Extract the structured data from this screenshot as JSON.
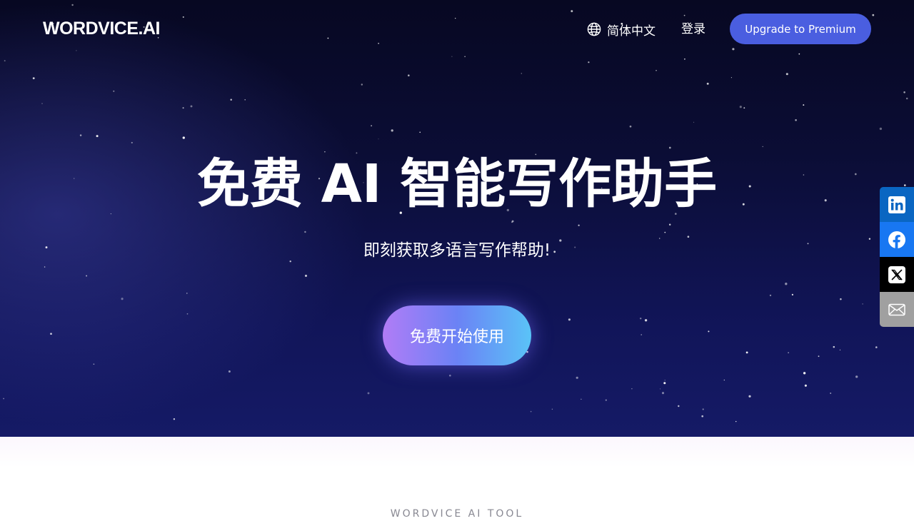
{
  "header": {
    "logo_text": "WORDVICE.AI",
    "language_label": "简体中文",
    "login_label": "登录",
    "upgrade_label": "Upgrade to Premium",
    "language_icon": "globe-icon"
  },
  "hero": {
    "title": "免费 AI 智能写作助手",
    "subtitle": "即刻获取多语言写作帮助!",
    "cta_label": "免费开始使用"
  },
  "social": [
    {
      "name": "linkedin",
      "icon": "linkedin-icon",
      "color": "#0a66c2"
    },
    {
      "name": "facebook",
      "icon": "facebook-icon",
      "color": "#1877f2"
    },
    {
      "name": "x",
      "icon": "x-icon",
      "color": "#000000"
    },
    {
      "name": "email",
      "icon": "email-icon",
      "color": "#a0a0a0"
    }
  ],
  "section": {
    "tag": "WORDVICE AI TOOL"
  },
  "colors": {
    "upgrade_button": "#4a5ee0",
    "hero_dark": "#070822",
    "hero_light": "#151a66",
    "cta_gradient_start": "#b17cf6",
    "cta_gradient_end": "#5ac3f7"
  }
}
